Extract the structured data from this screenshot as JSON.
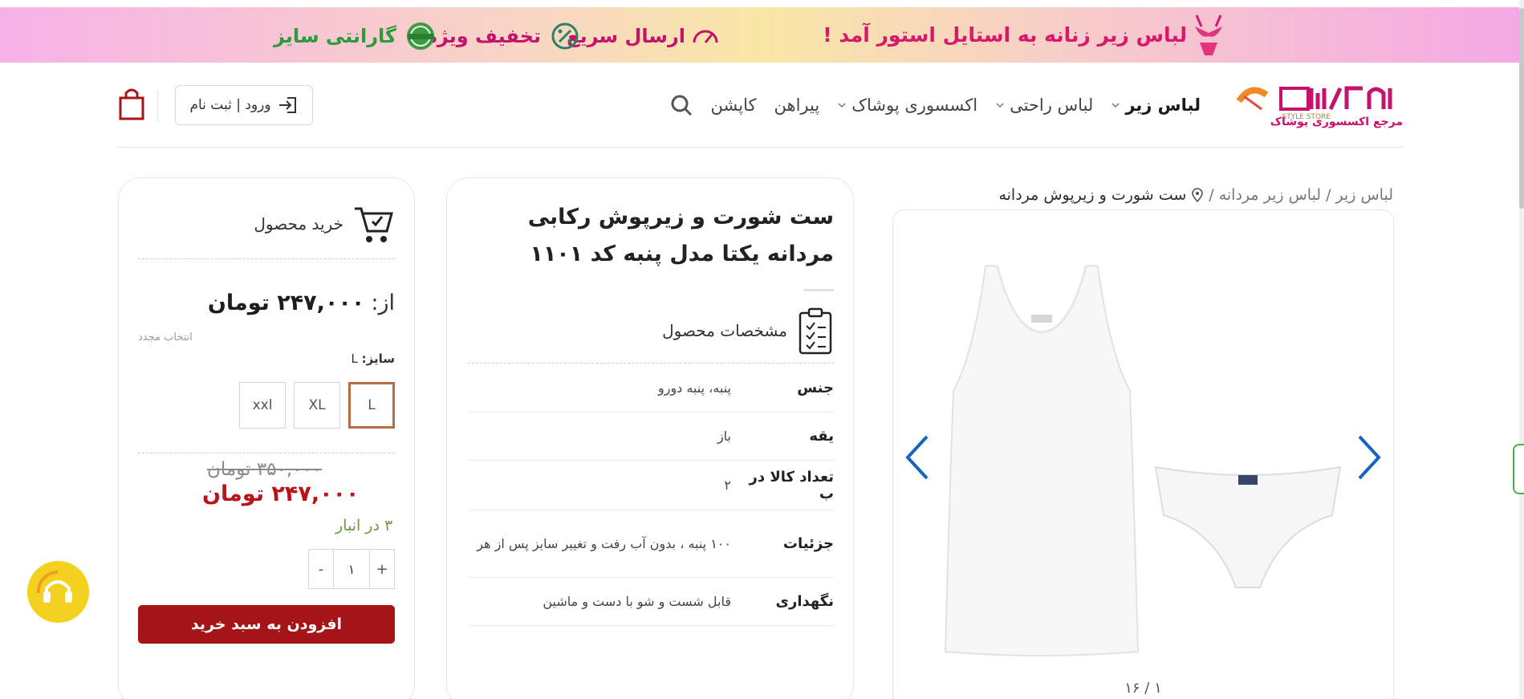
{
  "banner": {
    "main_text": "لباس زیر زنانه به استایل استور آمد !",
    "features": [
      "ارسال سریع",
      "تخفیف ویژه",
      "گارانتی سایز"
    ]
  },
  "header": {
    "logo_tagline": "مرجع اکسسوری پوشاک",
    "nav_items": [
      {
        "label": "لباس زیر",
        "has_dropdown": true
      },
      {
        "label": "لباس راحتی",
        "has_dropdown": true
      },
      {
        "label": "اکسسوری پوشاک",
        "has_dropdown": true
      },
      {
        "label": "پیراهن",
        "has_dropdown": false
      },
      {
        "label": "کاپشن",
        "has_dropdown": false
      }
    ],
    "login_label": "ورود | ثبت نام",
    "icons": {
      "search": "search-icon",
      "login": "login-arrow-icon",
      "cart": "shopping-bag-icon"
    }
  },
  "breadcrumb": {
    "items": [
      "لباس زیر",
      "لباس زیر مردانه"
    ],
    "separator": "/",
    "current": "ست شورت و زیرپوش مردانه"
  },
  "gallery": {
    "counter": "۱ / ۱۶",
    "arrow_color": "#1565c0"
  },
  "product": {
    "title": "ست شورت و زیرپوش رکابی مردانه یکتا مدل پنبه کد ۱۱۰۱",
    "specs_heading": "مشخصات محصول",
    "specs": [
      {
        "key": "جنس",
        "value": "پنبه، پنبه دورو"
      },
      {
        "key": "یقه",
        "value": "باز"
      },
      {
        "key": "تعداد کالا در ب",
        "value": "۲"
      },
      {
        "key": "جزئیات",
        "value": "۱۰۰ پنبه ، بدون آب رفت و تغییر سایز پس از هر"
      },
      {
        "key": "نگهداری",
        "value": "قابل شست و شو با دست و ماشین"
      }
    ]
  },
  "buy_box": {
    "heading": "خرید محصول",
    "from_prefix": "از:",
    "from_price": "۲۴۷,۰۰۰ تومان",
    "reset_label": "انتخاب مجدد",
    "size_label": "سایز:",
    "size_selected": "L",
    "sizes": [
      "L",
      "XL",
      "xxl"
    ],
    "old_price": "۳۵۰,۰۰۰ تومان",
    "new_price": "۲۴۷,۰۰۰ تومان",
    "stock": "۳ در انبار",
    "qty_minus": "-",
    "qty_value": "۱",
    "qty_plus": "+",
    "add_to_cart": "افزودن به سبد خرید"
  },
  "colors": {
    "brand_red": "#a51417",
    "price_red": "#b8141a",
    "stock_green": "#6d9a3f",
    "selected_border": "#b86b48",
    "support_yellow": "#f2d21f"
  }
}
